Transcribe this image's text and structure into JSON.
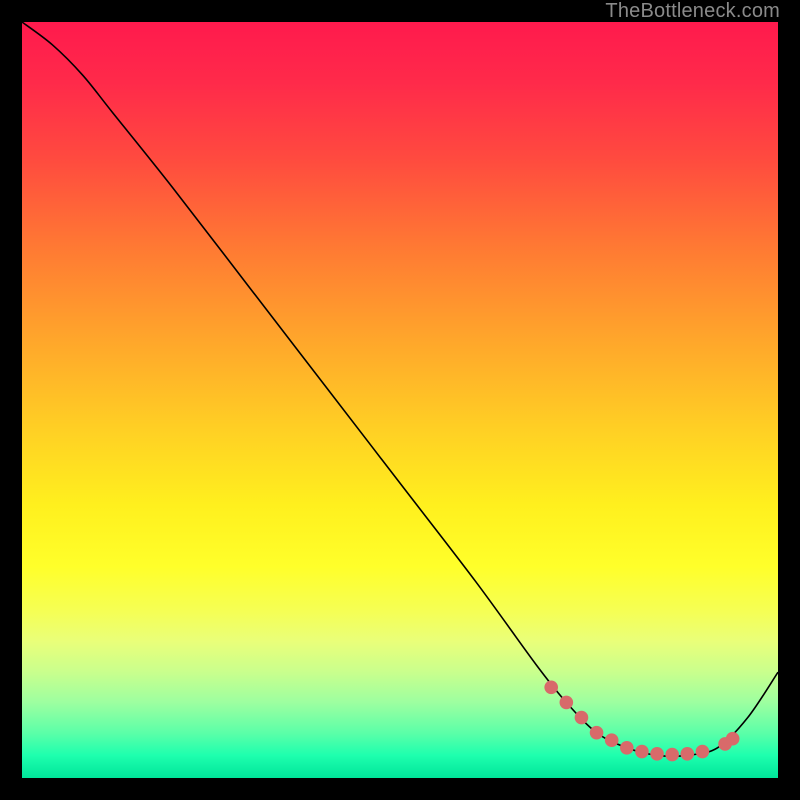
{
  "watermark": "TheBottleneck.com",
  "chart_data": {
    "type": "line",
    "title": "",
    "xlabel": "",
    "ylabel": "",
    "xlim": [
      0,
      100
    ],
    "ylim": [
      0,
      100
    ],
    "series": [
      {
        "name": "curve",
        "x": [
          0,
          4,
          8,
          12,
          20,
          30,
          40,
          50,
          60,
          68,
          72,
          76,
          80,
          84,
          88,
          92,
          96,
          100
        ],
        "y": [
          100,
          97,
          93,
          88,
          78,
          65,
          52,
          39,
          26,
          15,
          10,
          6,
          4,
          3,
          3,
          4,
          8,
          14
        ]
      }
    ],
    "highlight_points": {
      "name": "marked-range",
      "color": "#d86a6a",
      "x": [
        70,
        72,
        74,
        76,
        78,
        80,
        82,
        84,
        86,
        88,
        90,
        93,
        94
      ],
      "y": [
        12,
        10,
        8,
        6,
        5,
        4,
        3.5,
        3.2,
        3.1,
        3.2,
        3.5,
        4.5,
        5.2
      ]
    },
    "background": {
      "type": "vertical-gradient",
      "stops": [
        {
          "pos": 0.0,
          "color": "#ff1a4d"
        },
        {
          "pos": 0.3,
          "color": "#ff7a33"
        },
        {
          "pos": 0.55,
          "color": "#ffd024"
        },
        {
          "pos": 0.72,
          "color": "#ffff2a"
        },
        {
          "pos": 0.88,
          "color": "#9dffa0"
        },
        {
          "pos": 1.0,
          "color": "#00e59a"
        }
      ]
    }
  }
}
